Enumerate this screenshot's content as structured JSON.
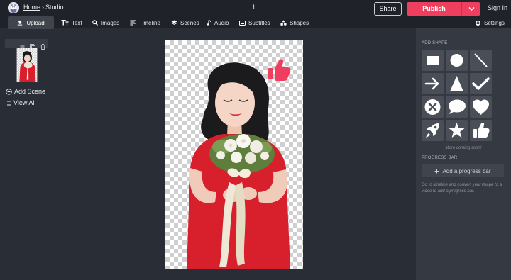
{
  "header": {
    "breadcrumb_home": "Home",
    "breadcrumb_separator": "›",
    "breadcrumb_current": "Studio",
    "page_number": "1",
    "share_label": "Share",
    "publish_label": "Publish",
    "signin_label": "Sign In"
  },
  "toolbar": {
    "upload_label": "Upload",
    "text_label": "Text",
    "images_label": "Images",
    "timeline_label": "Timeline",
    "scenes_label": "Scenes",
    "audio_label": "Audio",
    "subtitles_label": "Subtitles",
    "shapes_label": "Shapes",
    "settings_label": "Settings"
  },
  "scenes_panel": {
    "add_scene_label": "Add Scene",
    "view_all_label": "View All"
  },
  "shapes_panel": {
    "add_shape_title": "ADD SHAPE",
    "shapes": [
      "rectangle",
      "circle",
      "line",
      "arrow",
      "triangle",
      "checkmark",
      "x-circle",
      "speech-bubble",
      "heart",
      "rocket",
      "star",
      "thumbs-up"
    ],
    "more_coming": "More coming soon!",
    "progress_bar_title": "PROGRESS BAR",
    "add_progress_label": "Add a progress bar",
    "progress_help": "Go to timeline and convert your image to a video to add a progress bar."
  },
  "colors": {
    "accent": "#f03e5e",
    "topbar": "#1f2228",
    "background": "#292d35",
    "panel": "#353942",
    "shape_tile": "#4a4e57",
    "dress": "#d81f2c"
  }
}
